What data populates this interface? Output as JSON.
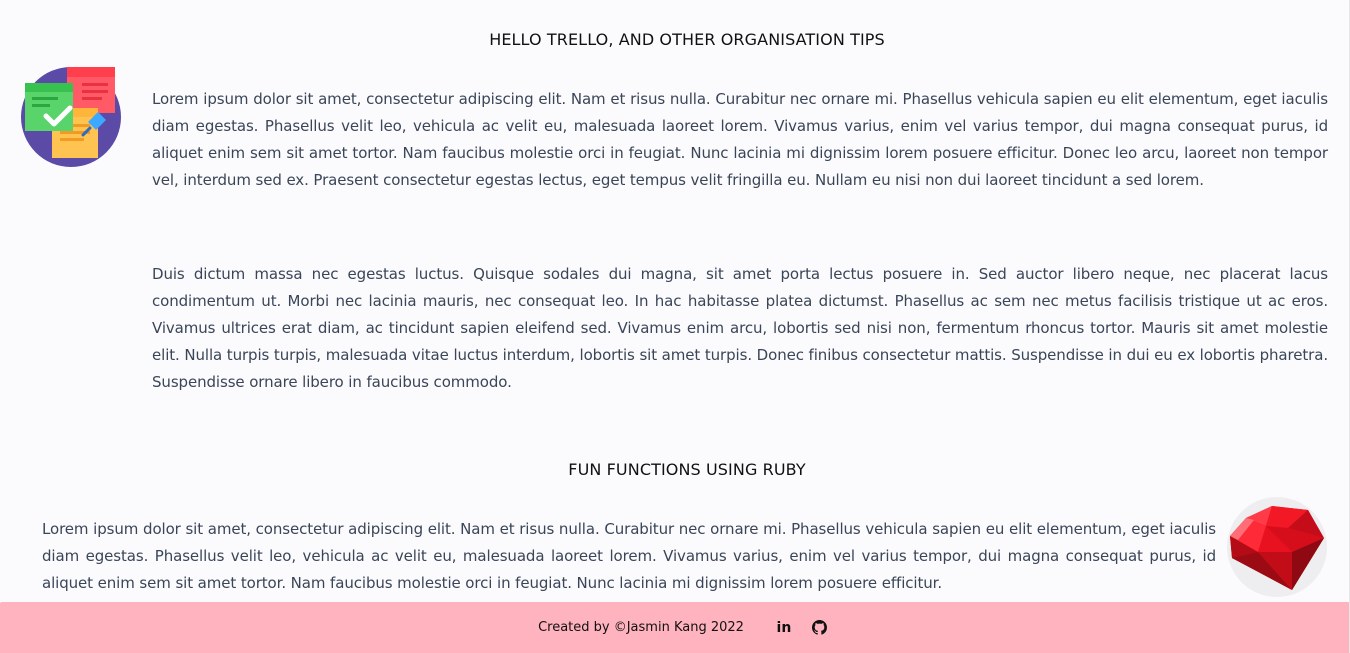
{
  "posts": [
    {
      "title": "HELLO TRELLO, AND OTHER ORGANISATION TIPS",
      "icon": "sticky-notes-icon",
      "paragraphs": [
        "Lorem ipsum dolor sit amet, consectetur adipiscing elit. Nam et risus nulla. Curabitur nec ornare mi. Phasellus vehicula sapien eu elit elementum, eget iaculis diam egestas. Phasellus velit leo, vehicula ac velit eu, malesuada laoreet lorem. Vivamus varius, enim vel varius tempor, dui magna consequat purus, id aliquet enim sem sit amet tortor. Nam faucibus molestie orci in feugiat. Nunc lacinia mi dignissim lorem posuere efficitur. Donec leo arcu, laoreet non tempor vel, interdum sed ex. Praesent consectetur egestas lectus, eget tempus velit fringilla eu. Nullam eu nisi non dui laoreet tincidunt a sed lorem.",
        "Duis dictum massa nec egestas luctus. Quisque sodales dui magna, sit amet porta lectus posuere in. Sed auctor libero neque, nec placerat lacus condimentum ut. Morbi nec lacinia mauris, nec consequat leo. In hac habitasse platea dictumst. Phasellus ac sem nec metus facilisis tristique ut ac eros. Vivamus ultrices erat diam, ac tincidunt sapien eleifend sed. Vivamus enim arcu, lobortis sed nisi non, fermentum rhoncus tortor. Mauris sit amet molestie elit. Nulla turpis turpis, malesuada vitae luctus interdum, lobortis sit amet turpis. Donec finibus consectetur mattis. Suspendisse in dui eu ex lobortis pharetra. Suspendisse ornare libero in faucibus commodo."
      ]
    },
    {
      "title": "FUN FUNCTIONS USING RUBY",
      "icon": "ruby-gem-icon",
      "paragraphs": [
        "Lorem ipsum dolor sit amet, consectetur adipiscing elit. Nam et risus nulla. Curabitur nec ornare mi. Phasellus vehicula sapien eu elit elementum, eget iaculis diam egestas. Phasellus velit leo, vehicula ac velit eu, malesuada laoreet lorem. Vivamus varius, enim vel varius tempor, dui magna consequat purus, id aliquet enim sem sit amet tortor. Nam faucibus molestie orci in feugiat. Nunc lacinia mi dignissim lorem posuere efficitur."
      ]
    }
  ],
  "footer": {
    "text": "Created by ©Jasmin Kang 2022",
    "links": [
      {
        "icon": "linkedin-icon",
        "glyph": "in"
      },
      {
        "icon": "github-icon"
      }
    ],
    "background": "#ffb3bf"
  },
  "colors": {
    "page_background": "#fbfbfd",
    "body_text": "#3a4558",
    "heading_text": "#111111"
  }
}
